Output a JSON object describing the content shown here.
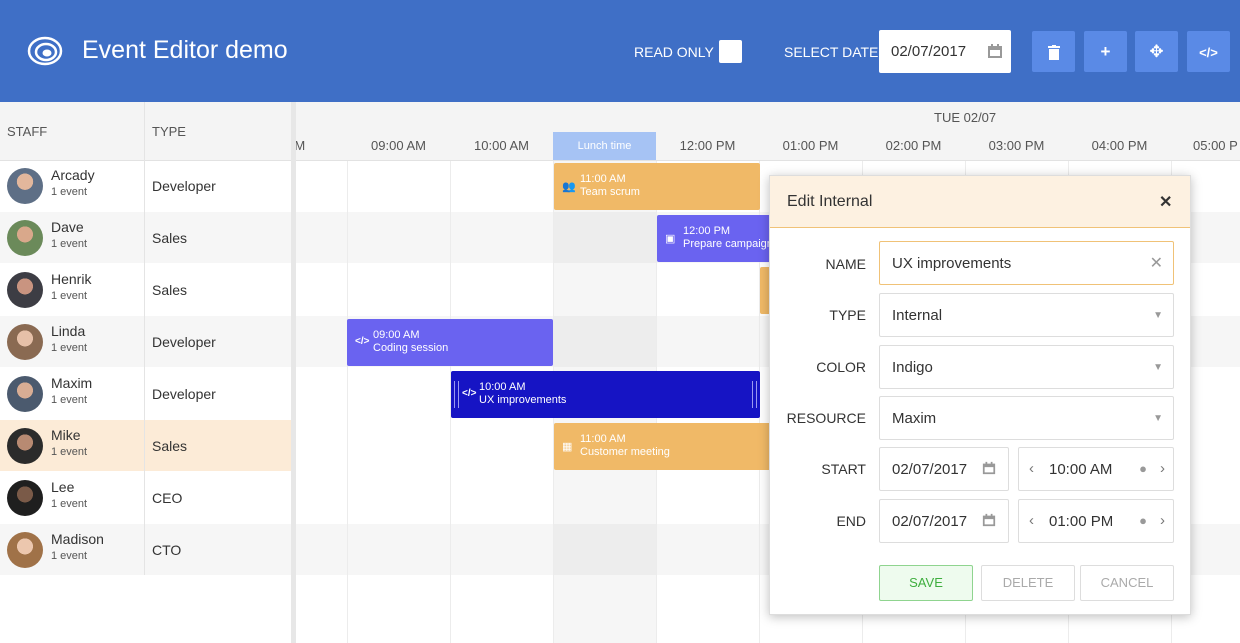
{
  "header": {
    "title": "Event Editor demo",
    "read_only_label": "READ ONLY",
    "select_date_label": "SELECT DATE",
    "selected_date": "02/07/2017",
    "buttons": [
      {
        "icon": "trash-icon"
      },
      {
        "icon": "plus-icon"
      },
      {
        "icon": "move-icon"
      },
      {
        "icon": "code-icon"
      }
    ]
  },
  "grid": {
    "staff_header": "STAFF",
    "type_header": "TYPE",
    "day_label": "TUE 02/07",
    "hours": [
      "AM",
      "09:00 AM",
      "10:00 AM",
      "Lunch time",
      "12:00 PM",
      "01:00 PM",
      "02:00 PM",
      "03:00 PM",
      "04:00 PM",
      "05:00 P"
    ]
  },
  "staff": [
    {
      "name": "Arcady",
      "count": "1 event",
      "type": "Developer"
    },
    {
      "name": "Dave",
      "count": "1 event",
      "type": "Sales"
    },
    {
      "name": "Henrik",
      "count": "1 event",
      "type": "Sales"
    },
    {
      "name": "Linda",
      "count": "1 event",
      "type": "Developer"
    },
    {
      "name": "Maxim",
      "count": "1 event",
      "type": "Developer"
    },
    {
      "name": "Mike",
      "count": "1 event",
      "type": "Sales"
    },
    {
      "name": "Lee",
      "count": "1 event",
      "type": "CEO"
    },
    {
      "name": "Madison",
      "count": "1 event",
      "type": "CTO"
    }
  ],
  "events": [
    {
      "time": "11:00 AM",
      "title": "Team scrum",
      "icon": "users-icon",
      "color": "#f0b967"
    },
    {
      "time": "12:00 PM",
      "title": "Prepare campaign",
      "icon": "image-icon",
      "color": "#6a63f0"
    },
    {
      "time": "09:00 AM",
      "title": "Coding session",
      "icon": "code-icon",
      "color": "#6a63f0"
    },
    {
      "time": "10:00 AM",
      "title": "UX improvements",
      "icon": "code-icon",
      "color": "#1614c4"
    },
    {
      "time": "11:00 AM",
      "title": "Customer meeting",
      "icon": "calendar-icon",
      "color": "#f0b967"
    }
  ],
  "editor": {
    "title": "Edit Internal",
    "name_label": "NAME",
    "name_value": "UX improvements",
    "type_label": "TYPE",
    "type_value": "Internal",
    "color_label": "COLOR",
    "color_value": "Indigo",
    "resource_label": "RESOURCE",
    "resource_value": "Maxim",
    "start_label": "START",
    "start_date": "02/07/2017",
    "start_time": "10:00 AM",
    "end_label": "END",
    "end_date": "02/07/2017",
    "end_time": "01:00 PM",
    "save_label": "SAVE",
    "delete_label": "DELETE",
    "cancel_label": "CANCEL"
  },
  "colors": {
    "header": "#3f6fc6",
    "orange": "#f0b967",
    "indigo": "#6a63f0",
    "navy": "#1614c4"
  }
}
